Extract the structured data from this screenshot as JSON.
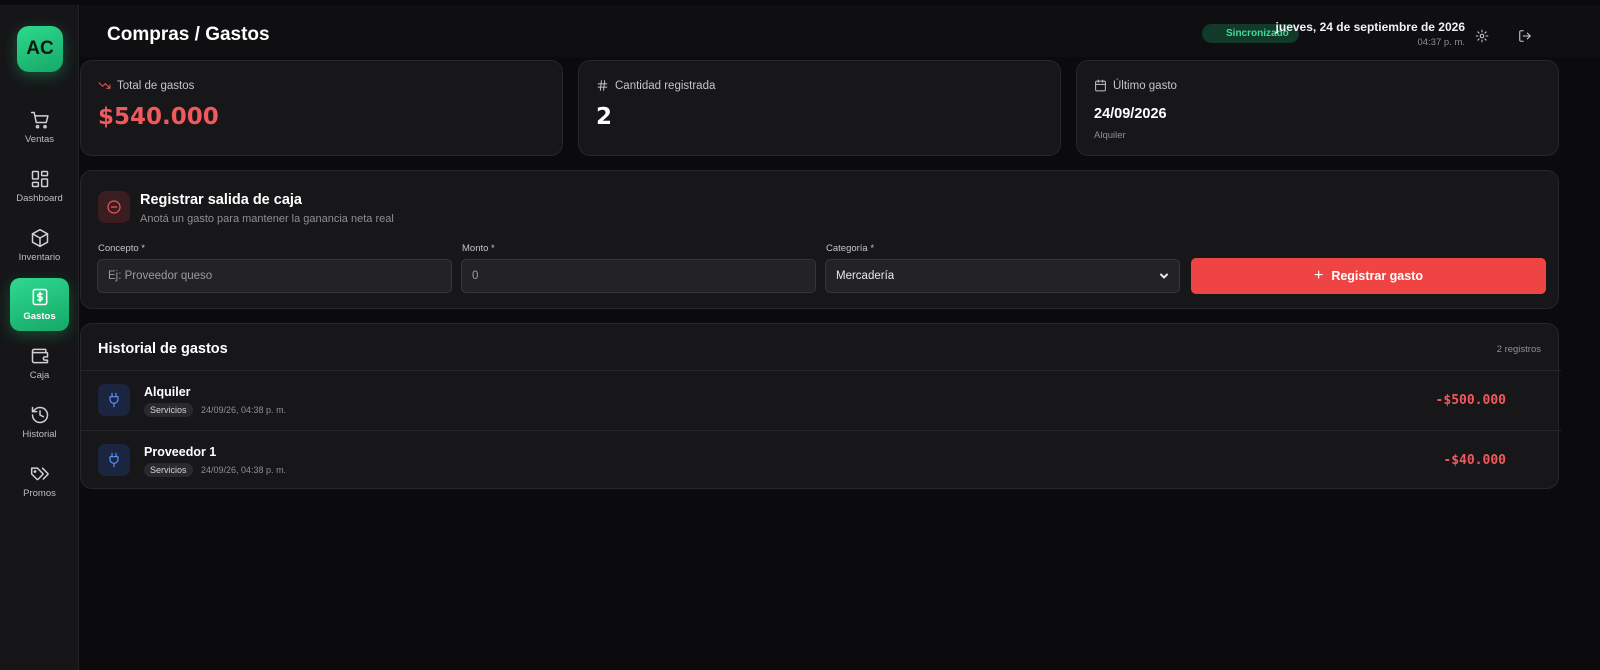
{
  "logo": {
    "text": "AC"
  },
  "sidebar": {
    "items": [
      {
        "label": "Ventas",
        "icon": "cart-icon"
      },
      {
        "label": "Dashboard",
        "icon": "grid-icon"
      },
      {
        "label": "Inventario",
        "icon": "box-icon"
      },
      {
        "label": "Gastos",
        "icon": "dollar-receipt-icon",
        "active": true
      },
      {
        "label": "Caja",
        "icon": "wallet-icon"
      },
      {
        "label": "Historial",
        "icon": "history-icon"
      },
      {
        "label": "Promos",
        "icon": "tags-icon"
      }
    ]
  },
  "header": {
    "title": "Compras / Gastos",
    "sync_status": "Sincronizado",
    "date": "jueves, 24 de septiembre de 2026",
    "time": "04:37 p. m.",
    "icons": [
      "settings-icon",
      "logout-icon"
    ]
  },
  "stats": {
    "total": {
      "label": "Total de gastos",
      "value": "$540.000",
      "icon": "trending-down-icon"
    },
    "count": {
      "label": "Cantidad registrada",
      "value": "2",
      "icon": "hash-icon"
    },
    "last": {
      "label": "Último gasto",
      "value": "24/09/2026",
      "sub": "Alquiler",
      "icon": "calendar-icon"
    }
  },
  "form": {
    "title": "Registrar salida de caja",
    "subtitle": "Anotá un gasto para mantener la ganancia neta real",
    "concept_label": "Concepto *",
    "concept_placeholder": "Ej: Proveedor queso",
    "concept_value": "",
    "amount_label": "Monto *",
    "amount_placeholder": "0",
    "amount_value": "",
    "category_label": "Categoría *",
    "category_value": "Mercadería",
    "submit_label": "Registrar gasto"
  },
  "history": {
    "title": "Historial de gastos",
    "count": "2 registros",
    "rows": [
      {
        "title": "Alquiler",
        "category": "Servicios",
        "date": "24/09/26, 04:38 p. m.",
        "amount": "-$500.000",
        "icon": "plug-icon"
      },
      {
        "title": "Proveedor 1",
        "category": "Servicios",
        "date": "24/09/26, 04:38 p. m.",
        "amount": "-$40.000",
        "icon": "plug-icon"
      }
    ]
  },
  "colors": {
    "accent_green": "#22c57d",
    "danger_red": "#ef4444",
    "background": "#0b0b0d",
    "card": "#17171a"
  }
}
